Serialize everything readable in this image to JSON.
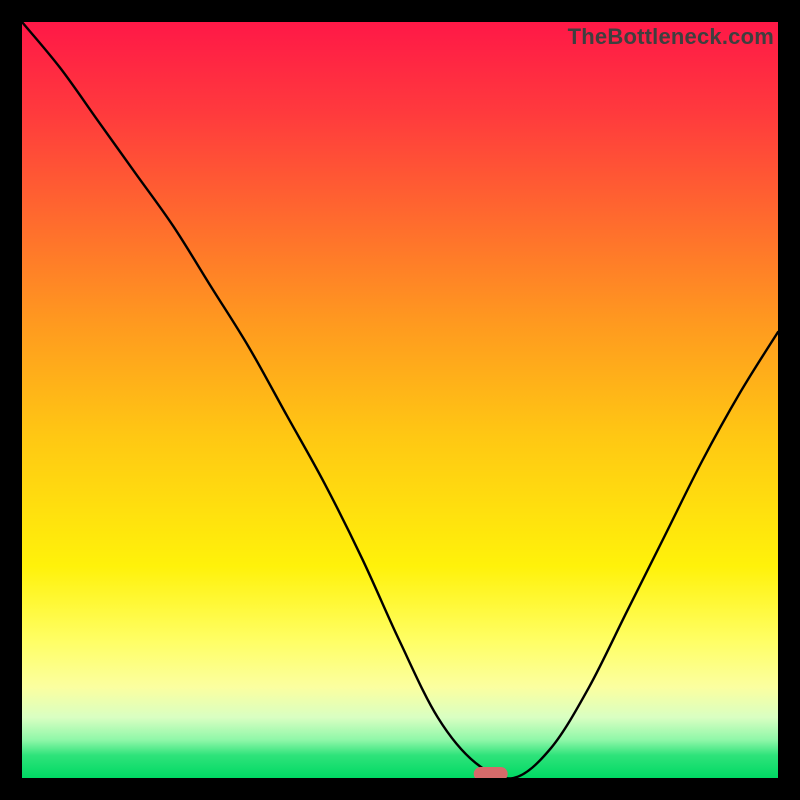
{
  "watermark": "TheBottleneck.com",
  "colors": {
    "curve": "#000000",
    "marker": "#d66a6a",
    "frame": "#000000"
  },
  "chart_data": {
    "type": "line",
    "title": "",
    "xlabel": "",
    "ylabel": "",
    "xlim": [
      0,
      100
    ],
    "ylim": [
      0,
      100
    ],
    "grid": false,
    "x": [
      0,
      5,
      10,
      15,
      20,
      25,
      30,
      35,
      40,
      45,
      50,
      55,
      60,
      65,
      70,
      75,
      80,
      85,
      90,
      95,
      100
    ],
    "values": [
      100,
      94,
      87,
      80,
      73,
      65,
      57,
      48,
      39,
      29,
      18,
      8,
      2,
      0,
      4,
      12,
      22,
      32,
      42,
      51,
      59
    ],
    "minimum": {
      "x": 62,
      "value": 0,
      "marker": true
    }
  }
}
